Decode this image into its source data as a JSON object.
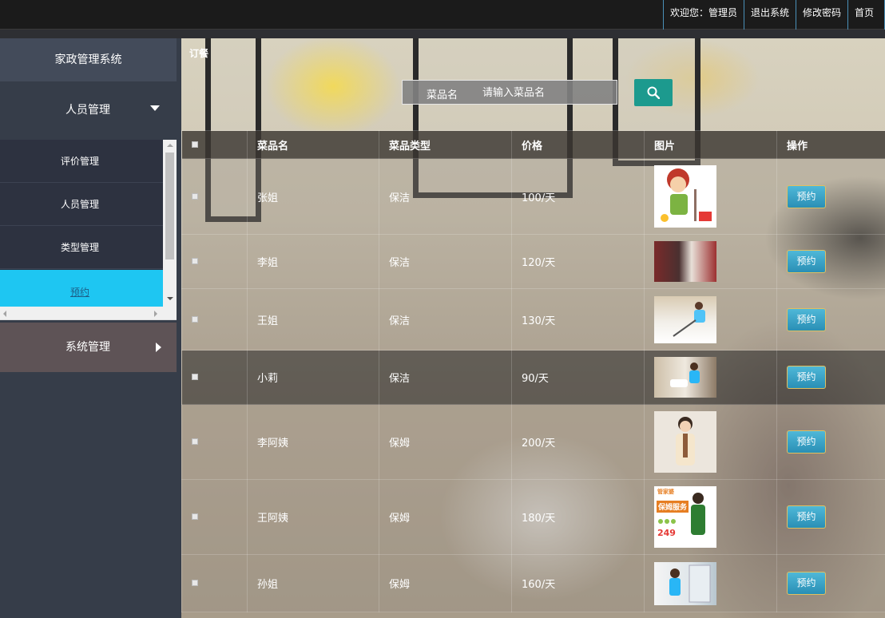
{
  "topbar": {
    "welcome": "欢迎您：管理员",
    "logout": "退出系统",
    "change_password": "修改密码",
    "home": "首页"
  },
  "sidebar": {
    "system_title": "家政管理系统",
    "people_menu": "人员管理",
    "system_menu": "系统管理",
    "items": [
      {
        "label": "评价管理",
        "active": false
      },
      {
        "label": "人员管理",
        "active": false
      },
      {
        "label": "类型管理",
        "active": false
      },
      {
        "label": "预约",
        "active": true
      }
    ]
  },
  "main": {
    "breadcrumb": "订餐",
    "search": {
      "label": "菜品名",
      "placeholder": "请输入菜品名",
      "value": ""
    },
    "columns": [
      "菜品名",
      "菜品类型",
      "价格",
      "图片",
      "操作"
    ],
    "rows": [
      {
        "name": "张姐",
        "type": "保洁",
        "price": "100/天",
        "action": "预约",
        "image_icon": "cartoon-cleaner-image"
      },
      {
        "name": "李姐",
        "type": "保洁",
        "price": "120/天",
        "action": "预约",
        "image_icon": "cleaning-staff-photo"
      },
      {
        "name": "王姐",
        "type": "保洁",
        "price": "130/天",
        "action": "预约",
        "image_icon": "vacuum-cleaning-photo"
      },
      {
        "name": "小莉",
        "type": "保洁",
        "price": "90/天",
        "action": "预约",
        "image_icon": "cleaning-staff-photo"
      },
      {
        "name": "李阿姨",
        "type": "保姆",
        "price": "200/天",
        "action": "预约",
        "image_icon": "nanny-portrait-photo"
      },
      {
        "name": "王阿姨",
        "type": "保姆",
        "price": "180/天",
        "action": "预约",
        "image_icon": "nanny-service-ad-image"
      },
      {
        "name": "孙姐",
        "type": "保姆",
        "price": "160/天",
        "action": "预约",
        "image_icon": "fridge-cleaning-photo"
      }
    ],
    "ad_image": {
      "brand": "管家婆",
      "title": "保姆服务",
      "price": "249"
    }
  },
  "colors": {
    "topbar": "#1b1b1b",
    "sidebar": "#363d49",
    "active_item": "#1ec6f2",
    "system_menu": "#5e5356",
    "search_button": "#1c9a8e",
    "book_button": "#2a8fb5"
  }
}
